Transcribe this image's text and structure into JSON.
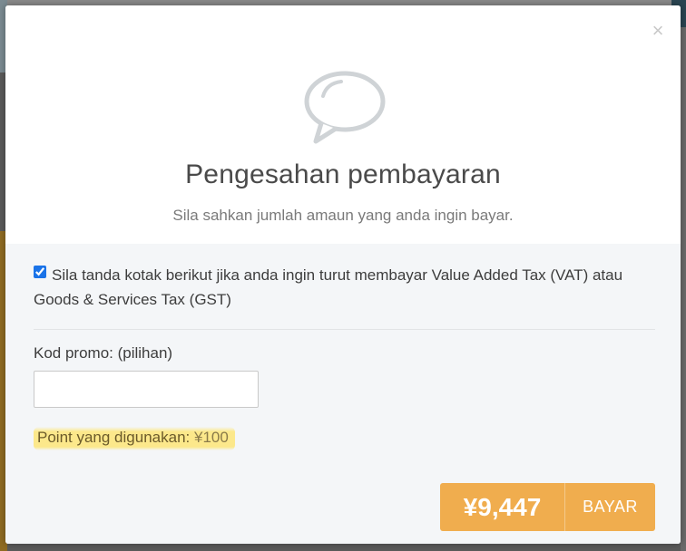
{
  "modal": {
    "close_symbol": "×",
    "icon": "speech-bubble-icon",
    "title": "Pengesahan pembayaran",
    "subtitle": "Sila sahkan jumlah amaun yang anda ingin bayar."
  },
  "vat": {
    "checked": true,
    "text": "Sila tanda kotak berikut jika anda ingin turut membayar Value Added Tax (VAT) atau Goods & Services Tax (GST)"
  },
  "promo": {
    "label": "Kod promo: (pilihan)",
    "value": "",
    "placeholder": ""
  },
  "points": {
    "label": "Point yang digunakan:",
    "value": "¥100"
  },
  "pay": {
    "amount": "¥9,447",
    "label": "BAYAR"
  },
  "colors": {
    "accent": "#f0ad4e",
    "highlight": "#fde678",
    "body_bg": "#f4f6f8"
  }
}
